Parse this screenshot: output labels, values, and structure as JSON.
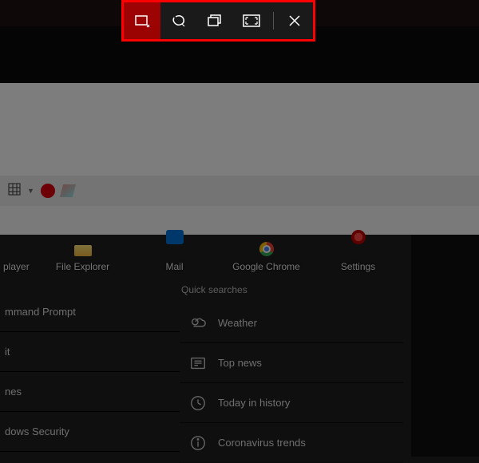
{
  "snip_toolbar": {
    "modes": [
      "rectangular-snip",
      "freeform-snip",
      "window-snip",
      "fullscreen-snip"
    ],
    "close": "Close"
  },
  "app_tiles": [
    {
      "label": "player",
      "name": "media-player"
    },
    {
      "label": "File Explorer",
      "name": "file-explorer"
    },
    {
      "label": "Mail",
      "name": "mail"
    },
    {
      "label": "Google Chrome",
      "name": "google-chrome"
    },
    {
      "label": "Settings",
      "name": "settings"
    }
  ],
  "left_items": [
    "mmand Prompt",
    "it",
    "nes",
    "dows Security"
  ],
  "quick_searches_header": "Quick searches",
  "quick_searches": [
    {
      "label": "Weather",
      "icon": "weather"
    },
    {
      "label": "Top news",
      "icon": "news"
    },
    {
      "label": "Today in history",
      "icon": "clock"
    },
    {
      "label": "Coronavirus trends",
      "icon": "info"
    }
  ]
}
